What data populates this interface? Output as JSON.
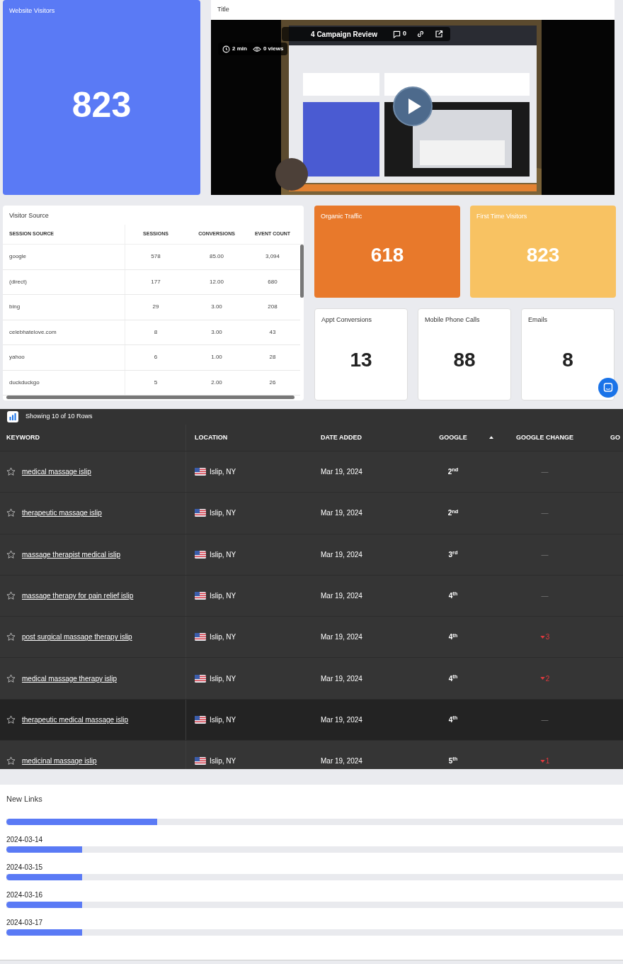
{
  "website_visitors": {
    "title": "Website Visitors",
    "value": "823"
  },
  "video": {
    "title": "Title",
    "video_title": "4 Campaign Review",
    "comments": "0",
    "duration": "2 min",
    "views": "0 views",
    "kind": "picture"
  },
  "visitor_source": {
    "title": "Visitor Source",
    "columns": [
      "SESSION SOURCE",
      "SESSIONS",
      "CONVERSIONS",
      "EVENT COUNT"
    ],
    "rows": [
      [
        "google",
        "578",
        "85.00",
        "3,094"
      ],
      [
        "(direct)",
        "177",
        "12.00",
        "680"
      ],
      [
        "bing",
        "29",
        "3.00",
        "208"
      ],
      [
        "celebhatelove.com",
        "8",
        "3.00",
        "43"
      ],
      [
        "yahoo",
        "6",
        "1.00",
        "28"
      ],
      [
        "duckduckgo",
        "5",
        "2.00",
        "26"
      ]
    ]
  },
  "big_metrics": [
    {
      "title": "Organic Traffic",
      "value": "618",
      "color": "#e8792b"
    },
    {
      "title": "First Time Visitors",
      "value": "823",
      "color": "#f8c262"
    }
  ],
  "small_metrics": [
    {
      "title": "Appt Conversions",
      "value": "13"
    },
    {
      "title": "Mobile Phone Calls",
      "value": "88"
    },
    {
      "title": "Emails",
      "value": "8"
    }
  ],
  "keywords": {
    "summary": "Showing 10 of 10 Rows",
    "columns": [
      "KEYWORD",
      "LOCATION",
      "DATE ADDED",
      "GOOGLE",
      "GOOGLE CHANGE",
      "GO"
    ],
    "rows": [
      {
        "keyword": "medical massage islip",
        "location": "Islip, NY",
        "date": "Mar 19, 2024",
        "google": "2$^{nd}$",
        "kind": "none",
        "change": "—",
        "highlighted": false
      },
      {
        "keyword": "therapeutic massage islip",
        "location": "Islip, NY",
        "date": "Mar 19, 2024",
        "google": "2$^{nd}$",
        "kind": "none",
        "change": "—",
        "highlighted": false
      },
      {
        "keyword": "massage therapist medical islip",
        "location": "Islip, NY",
        "date": "Mar 19, 2024",
        "google": "3$^{rd}$",
        "kind": "none",
        "change": "—",
        "highlighted": false
      },
      {
        "keyword": "massage therapy for pain relief islip",
        "location": "Islip, NY",
        "date": "Mar 19, 2024",
        "google": "4$^{th}$",
        "kind": "none",
        "change": "—",
        "highlighted": false
      },
      {
        "keyword": "post surgical massage therapy islip",
        "location": "Islip, NY",
        "date": "Mar 19, 2024",
        "google": "4$^{th}$",
        "kind": "down",
        "change": "3",
        "highlighted": false
      },
      {
        "keyword": "medical massage therapy islip",
        "location": "Islip, NY",
        "date": "Mar 19, 2024",
        "google": "4$^{th}$",
        "kind": "down",
        "change": "2",
        "highlighted": false
      },
      {
        "keyword": "therapeutic medical massage islip",
        "location": "Islip, NY",
        "date": "Mar 19, 2024",
        "google": "4$^{th}$",
        "kind": "none",
        "change": "—",
        "highlighted": true
      },
      {
        "keyword": "medicinal massage islip",
        "location": "Islip, NY",
        "date": "Mar 19, 2024",
        "google": "5$^{th}$",
        "kind": "down",
        "change": "1",
        "highlighted": false
      }
    ]
  },
  "new_links": {
    "title": "New Links",
    "bars": [
      {
        "level": 0.245
      },
      {
        "label": "2024-03-14",
        "level": 0.123
      },
      {
        "label": "2024-03-15",
        "level": 0.123
      },
      {
        "label": "2024-03-16",
        "level": 0.123
      },
      {
        "label": "2024-03-17",
        "level": 0.123
      }
    ]
  }
}
